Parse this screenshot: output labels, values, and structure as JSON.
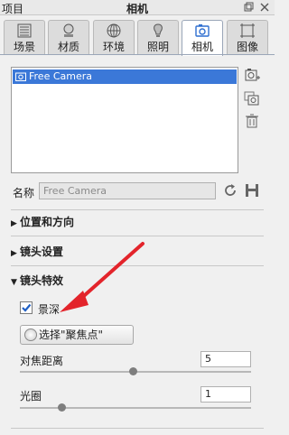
{
  "window": {
    "project_label": "项目",
    "title": "相机"
  },
  "tabs": [
    {
      "label": "场景",
      "icon": "scene-icon",
      "active": false
    },
    {
      "label": "材质",
      "icon": "material-icon",
      "active": false
    },
    {
      "label": "环境",
      "icon": "environment-icon",
      "active": false
    },
    {
      "label": "照明",
      "icon": "lighting-icon",
      "active": false
    },
    {
      "label": "相机",
      "icon": "camera-icon",
      "active": true
    },
    {
      "label": "图像",
      "icon": "image-icon",
      "active": false
    }
  ],
  "camera_list": {
    "items": [
      "Free Camera"
    ],
    "selected": "Free Camera"
  },
  "side_buttons": [
    "add-camera-icon",
    "duplicate-camera-icon",
    "delete-icon"
  ],
  "name": {
    "label": "名称",
    "value": "Free Camera"
  },
  "sections": {
    "position": "位置和方向",
    "lens": "镜头设置",
    "lens_effects": "镜头特效"
  },
  "dof": {
    "label": "景深",
    "checked": true
  },
  "pick_focus_button": "选择\"聚焦点\"",
  "focus_distance": {
    "label": "对焦距离",
    "value": "5",
    "slider_fraction": 0.49
  },
  "aperture": {
    "label": "光圈",
    "value": "1",
    "slider_fraction": 0.18
  },
  "colors": {
    "accent": "#3b78d8",
    "annotation_arrow": "#e3242b"
  }
}
